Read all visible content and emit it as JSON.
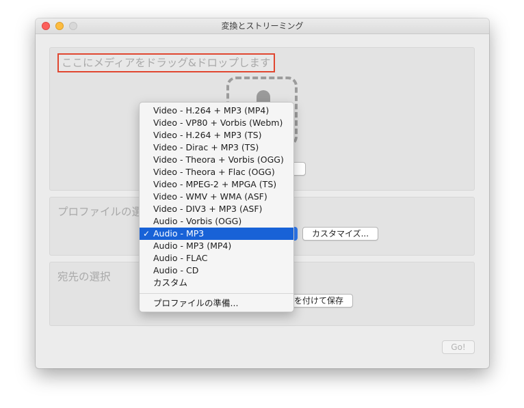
{
  "window": {
    "title": "変換とストリーミング"
  },
  "drop_area": {
    "label": "ここにメディアをドラッグ&ドロップします"
  },
  "profile_section": {
    "heading": "プロファイルの選",
    "customize_button": "カスタマイズ..."
  },
  "destination_section": {
    "heading": "宛先の選択",
    "save_as_button": "を付けて保存"
  },
  "go_button": "Go!",
  "profile_menu": {
    "items": [
      {
        "label": "Video - H.264 + MP3 (MP4)",
        "selected": false
      },
      {
        "label": "Video - VP80 + Vorbis (Webm)",
        "selected": false
      },
      {
        "label": "Video - H.264 + MP3 (TS)",
        "selected": false
      },
      {
        "label": "Video - Dirac + MP3 (TS)",
        "selected": false
      },
      {
        "label": "Video - Theora + Vorbis (OGG)",
        "selected": false
      },
      {
        "label": "Video - Theora + Flac (OGG)",
        "selected": false
      },
      {
        "label": "Video - MPEG-2 + MPGA (TS)",
        "selected": false
      },
      {
        "label": "Video - WMV + WMA (ASF)",
        "selected": false
      },
      {
        "label": "Video - DIV3 + MP3 (ASF)",
        "selected": false
      },
      {
        "label": "Audio - Vorbis (OGG)",
        "selected": false
      },
      {
        "label": "Audio - MP3",
        "selected": true
      },
      {
        "label": "Audio - MP3 (MP4)",
        "selected": false
      },
      {
        "label": "Audio - FLAC",
        "selected": false
      },
      {
        "label": "Audio - CD",
        "selected": false
      },
      {
        "label": "カスタム",
        "selected": false
      }
    ],
    "check_mark": "✓",
    "prepare_profile": "プロファイルの準備..."
  }
}
